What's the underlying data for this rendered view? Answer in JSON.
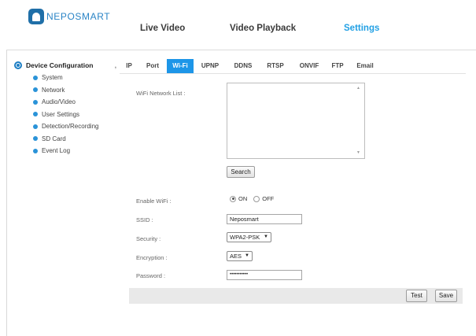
{
  "app": {
    "logo_text": "NEPOSMART"
  },
  "topnav": [
    {
      "label": "Live Video"
    },
    {
      "label": "Video Playback"
    },
    {
      "label": "Settings"
    }
  ],
  "sidebar": {
    "header": "Device Configuration",
    "caret": ",",
    "items": [
      {
        "label": "System"
      },
      {
        "label": "Network"
      },
      {
        "label": "Audio/Video"
      },
      {
        "label": "User Settings"
      },
      {
        "label": "Detection/Recording"
      },
      {
        "label": "SD Card"
      },
      {
        "label": "Event Log"
      }
    ]
  },
  "tabs": [
    {
      "label": "IP"
    },
    {
      "label": "Port"
    },
    {
      "label": "Wi-Fi"
    },
    {
      "label": "UPNP"
    },
    {
      "label": "DDNS"
    },
    {
      "label": "RTSP"
    },
    {
      "label": "ONVIF"
    },
    {
      "label": "FTP"
    },
    {
      "label": "Email"
    }
  ],
  "wifi": {
    "network_list_label": "WiFi Network List :",
    "search_label": "Search",
    "enable_label": "Enable WiFi :",
    "on_label": "ON",
    "off_label": "OFF",
    "enabled": "ON",
    "ssid_label": "SSID :",
    "ssid_value": "Neposmart",
    "security_label": "Security :",
    "security_value": "WPA2-PSK",
    "encryption_label": "Encryption :",
    "encryption_value": "AES",
    "password_label": "Password :",
    "password_value": "•••••••••••",
    "test_label": "Test",
    "save_label": "Save"
  },
  "colors": {
    "accent": "#1d96e8",
    "settings_active": "#22a0e4",
    "dot": "#2a93d8"
  },
  "icons": {
    "logo": "neposmart-logo-icon",
    "section": "device-config-icon",
    "bullet": "dot-icon"
  }
}
